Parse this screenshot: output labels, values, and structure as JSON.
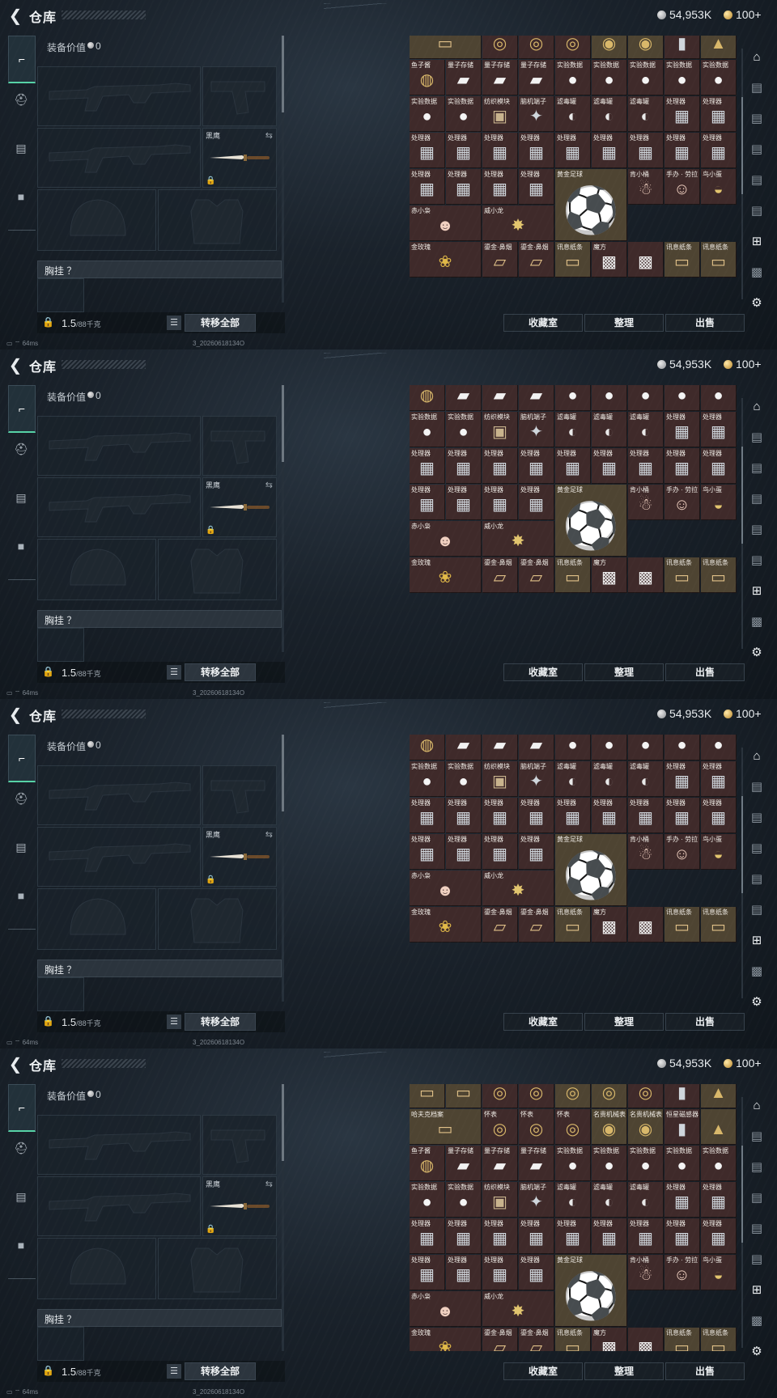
{
  "topbar": {
    "title": "仓库",
    "back_icon": "back-arrow-icon",
    "silver_currency": "54,953K",
    "gold_currency": "100+"
  },
  "categories": [
    {
      "icon": "pistol-icon",
      "glyph": "⌐",
      "active": true
    },
    {
      "icon": "helmet-icon",
      "glyph": "⛑",
      "active": false
    },
    {
      "icon": "backpack-icon",
      "glyph": "▤",
      "active": false
    },
    {
      "icon": "briefcase-icon",
      "glyph": "■",
      "active": false
    }
  ],
  "equipment": {
    "value_label": "装备价值",
    "value": "0",
    "knife_label": "黑鹰",
    "vest_label": "胸挂 ？",
    "weight_value": "1.5",
    "weight_capacity": "/88千克",
    "transfer_all": "转移全部"
  },
  "statusbar": {
    "ping": "64ms",
    "build": "3_20260618134O"
  },
  "buttons": {
    "collection": "收藏室",
    "organize": "整理",
    "sell": "出售"
  },
  "grid_rows": [
    [
      {
        "label": "",
        "icon": "document-icon",
        "glyph": "▭",
        "cls": "i-doc",
        "gold": true
      },
      {
        "label": "",
        "icon": "document-icon",
        "glyph": "▭",
        "cls": "i-doc",
        "gold": true
      },
      {
        "label": "",
        "icon": "watch-icon",
        "glyph": "◎",
        "cls": "i-watch"
      },
      {
        "label": "",
        "icon": "watch-icon",
        "glyph": "◎",
        "cls": "i-watch"
      },
      {
        "label": "",
        "icon": "watch-icon",
        "glyph": "◎",
        "cls": "i-watch",
        "gold": true
      },
      {
        "label": "",
        "icon": "watch-icon",
        "glyph": "◎",
        "cls": "i-watch",
        "gold": true
      },
      {
        "label": "",
        "icon": "watch-icon",
        "glyph": "◎",
        "cls": "i-watch"
      },
      {
        "label": "",
        "icon": "sensor-icon",
        "glyph": "▮",
        "cls": "i-chip"
      },
      {
        "label": "",
        "icon": "bullet-icon",
        "glyph": "▲",
        "cls": "i-watch",
        "gold": true
      }
    ],
    [
      {
        "label": "哈夫克档案",
        "icon": "document-icon",
        "glyph": "▭",
        "cls": "i-doc",
        "gold": true,
        "span": 2
      },
      {
        "label": "怀表",
        "icon": "pocket-watch-icon",
        "glyph": "◎",
        "cls": "i-watch"
      },
      {
        "label": "怀表",
        "icon": "pocket-watch-icon",
        "glyph": "◎",
        "cls": "i-watch"
      },
      {
        "label": "怀表",
        "icon": "pocket-watch-icon",
        "glyph": "◎",
        "cls": "i-watch"
      },
      {
        "label": "名贵机械表",
        "icon": "wristwatch-icon",
        "glyph": "◉",
        "cls": "i-watch",
        "gold": true
      },
      {
        "label": "名贵机械表",
        "icon": "wristwatch-icon",
        "glyph": "◉",
        "cls": "i-watch",
        "gold": true
      },
      {
        "label": "恒星磁感器",
        "icon": "sensor-icon",
        "glyph": "▮",
        "cls": "i-chip"
      },
      {
        "label": "",
        "icon": "bullet-icon",
        "glyph": "▲",
        "cls": "i-watch",
        "gold": true
      }
    ],
    [
      {
        "label": "鱼子酱",
        "icon": "caviar-tin-icon",
        "glyph": "◍",
        "cls": "i-watch"
      },
      {
        "label": "量子存储",
        "icon": "usb-drive-icon",
        "glyph": "▰",
        "cls": "i-usb"
      },
      {
        "label": "量子存储",
        "icon": "usb-drive-icon",
        "glyph": "▰",
        "cls": "i-usb"
      },
      {
        "label": "量子存储",
        "icon": "usb-drive-icon",
        "glyph": "▰",
        "cls": "i-usb"
      },
      {
        "label": "实验数据",
        "icon": "disc-icon",
        "glyph": "●",
        "cls": "i-disc"
      },
      {
        "label": "实验数据",
        "icon": "disc-icon",
        "glyph": "●",
        "cls": "i-disc"
      },
      {
        "label": "实验数据",
        "icon": "disc-icon",
        "glyph": "●",
        "cls": "i-disc"
      },
      {
        "label": "实验数据",
        "icon": "disc-icon",
        "glyph": "●",
        "cls": "i-disc"
      },
      {
        "label": "实验数据",
        "icon": "disc-icon",
        "glyph": "●",
        "cls": "i-disc"
      }
    ],
    [
      {
        "label": "实验数据",
        "icon": "disc-icon",
        "glyph": "●",
        "cls": "i-disc"
      },
      {
        "label": "实验数据",
        "icon": "disc-icon",
        "glyph": "●",
        "cls": "i-disc"
      },
      {
        "label": "纺织模块",
        "icon": "module-box-icon",
        "glyph": "▣",
        "cls": "i-box"
      },
      {
        "label": "脑机端子",
        "icon": "terminal-icon",
        "glyph": "✦",
        "cls": "i-chip"
      },
      {
        "label": "滤毒罐",
        "icon": "filter-canister-icon",
        "glyph": "◐",
        "cls": "i-can"
      },
      {
        "label": "滤毒罐",
        "icon": "filter-canister-icon",
        "glyph": "◐",
        "cls": "i-can"
      },
      {
        "label": "滤毒罐",
        "icon": "filter-canister-icon",
        "glyph": "◐",
        "cls": "i-can"
      },
      {
        "label": "处理器",
        "icon": "processor-icon",
        "glyph": "▦",
        "cls": "i-chip"
      },
      {
        "label": "处理器",
        "icon": "processor-icon",
        "glyph": "▦",
        "cls": "i-chip"
      }
    ],
    [
      {
        "label": "处理器",
        "icon": "processor-icon",
        "glyph": "▦",
        "cls": "i-chip"
      },
      {
        "label": "处理器",
        "icon": "processor-icon",
        "glyph": "▦",
        "cls": "i-chip"
      },
      {
        "label": "处理器",
        "icon": "processor-icon",
        "glyph": "▦",
        "cls": "i-chip"
      },
      {
        "label": "处理器",
        "icon": "processor-icon",
        "glyph": "▦",
        "cls": "i-chip"
      },
      {
        "label": "处理器",
        "icon": "processor-icon",
        "glyph": "▦",
        "cls": "i-chip"
      },
      {
        "label": "处理器",
        "icon": "processor-icon",
        "glyph": "▦",
        "cls": "i-chip"
      },
      {
        "label": "处理器",
        "icon": "processor-icon",
        "glyph": "▦",
        "cls": "i-chip"
      },
      {
        "label": "处理器",
        "icon": "processor-icon",
        "glyph": "▦",
        "cls": "i-chip"
      },
      {
        "label": "处理器",
        "icon": "processor-icon",
        "glyph": "▦",
        "cls": "i-chip"
      }
    ],
    [
      {
        "label": "处理器",
        "icon": "processor-icon",
        "glyph": "▦",
        "cls": "i-chip"
      },
      {
        "label": "处理器",
        "icon": "processor-icon",
        "glyph": "▦",
        "cls": "i-chip"
      },
      {
        "label": "处理器",
        "icon": "processor-icon",
        "glyph": "▦",
        "cls": "i-chip"
      },
      {
        "label": "处理器",
        "icon": "processor-icon",
        "glyph": "▦",
        "cls": "i-chip"
      },
      {
        "label": "黄金足球",
        "icon": "golden-football-icon",
        "glyph": "⚽",
        "cls": "i-ball",
        "big": true
      },
      {
        "label": "肯小桶",
        "icon": "figurine-icon",
        "glyph": "☃",
        "cls": "i-fig"
      },
      {
        "label": "手办 · 劳拉",
        "icon": "figurine-icon",
        "glyph": "☺",
        "cls": "i-fig"
      },
      {
        "label": "鸟小蛋",
        "icon": "egg-figurine-icon",
        "glyph": "◒",
        "cls": "i-ball"
      }
    ],
    [
      {
        "label": "赤小枭",
        "icon": "figurine-icon",
        "glyph": "☻",
        "cls": "i-fig",
        "span": 2
      },
      {
        "label": "威小龙",
        "icon": "figurine-icon",
        "glyph": "✸",
        "cls": "i-ball",
        "span": 2
      }
    ],
    [
      {
        "label": "金玫瑰",
        "icon": "golden-rose-icon",
        "glyph": "❀",
        "cls": "i-rose",
        "span": 2
      },
      {
        "label": "鎏金·鼻烟",
        "icon": "snuff-box-icon",
        "glyph": "▱",
        "cls": "i-doc"
      },
      {
        "label": "鎏金·鼻烟",
        "icon": "snuff-box-icon",
        "glyph": "▱",
        "cls": "i-doc"
      },
      {
        "label": "讯息纸条",
        "icon": "message-note-icon",
        "glyph": "▭",
        "cls": "i-doc",
        "gold": true
      },
      {
        "label": "魔方",
        "icon": "rubiks-cube-icon",
        "glyph": "▩",
        "cls": "i-cube"
      },
      {
        "label": "",
        "icon": "rubiks-cube-icon",
        "glyph": "▩",
        "cls": "i-cube"
      },
      {
        "label": "讯息纸条",
        "icon": "message-note-icon",
        "glyph": "▭",
        "cls": "i-doc",
        "gold": true
      },
      {
        "label": "讯息纸条",
        "icon": "message-note-icon",
        "glyph": "▭",
        "cls": "i-doc",
        "gold": true
      }
    ]
  ],
  "frames": [
    {
      "scroll": "bottom"
    },
    {
      "scroll": "lower"
    },
    {
      "scroll": "lower"
    },
    {
      "scroll": "upper"
    }
  ],
  "side_icons": [
    {
      "icon": "safe-box-icon",
      "glyph": "⌂",
      "bright": true
    },
    {
      "icon": "storage-tab-icon",
      "glyph": "▤"
    },
    {
      "icon": "storage-tab-icon",
      "glyph": "▤"
    },
    {
      "icon": "storage-tab-icon",
      "glyph": "▤"
    },
    {
      "icon": "storage-tab-icon",
      "glyph": "▤"
    },
    {
      "icon": "storage-tab-icon",
      "glyph": "▤"
    },
    {
      "icon": "scan-icon",
      "glyph": "⊞",
      "bright": true
    },
    {
      "icon": "qr-icon",
      "glyph": "▩"
    },
    {
      "icon": "settings-gear-icon",
      "glyph": "⚙",
      "bright": true
    }
  ]
}
